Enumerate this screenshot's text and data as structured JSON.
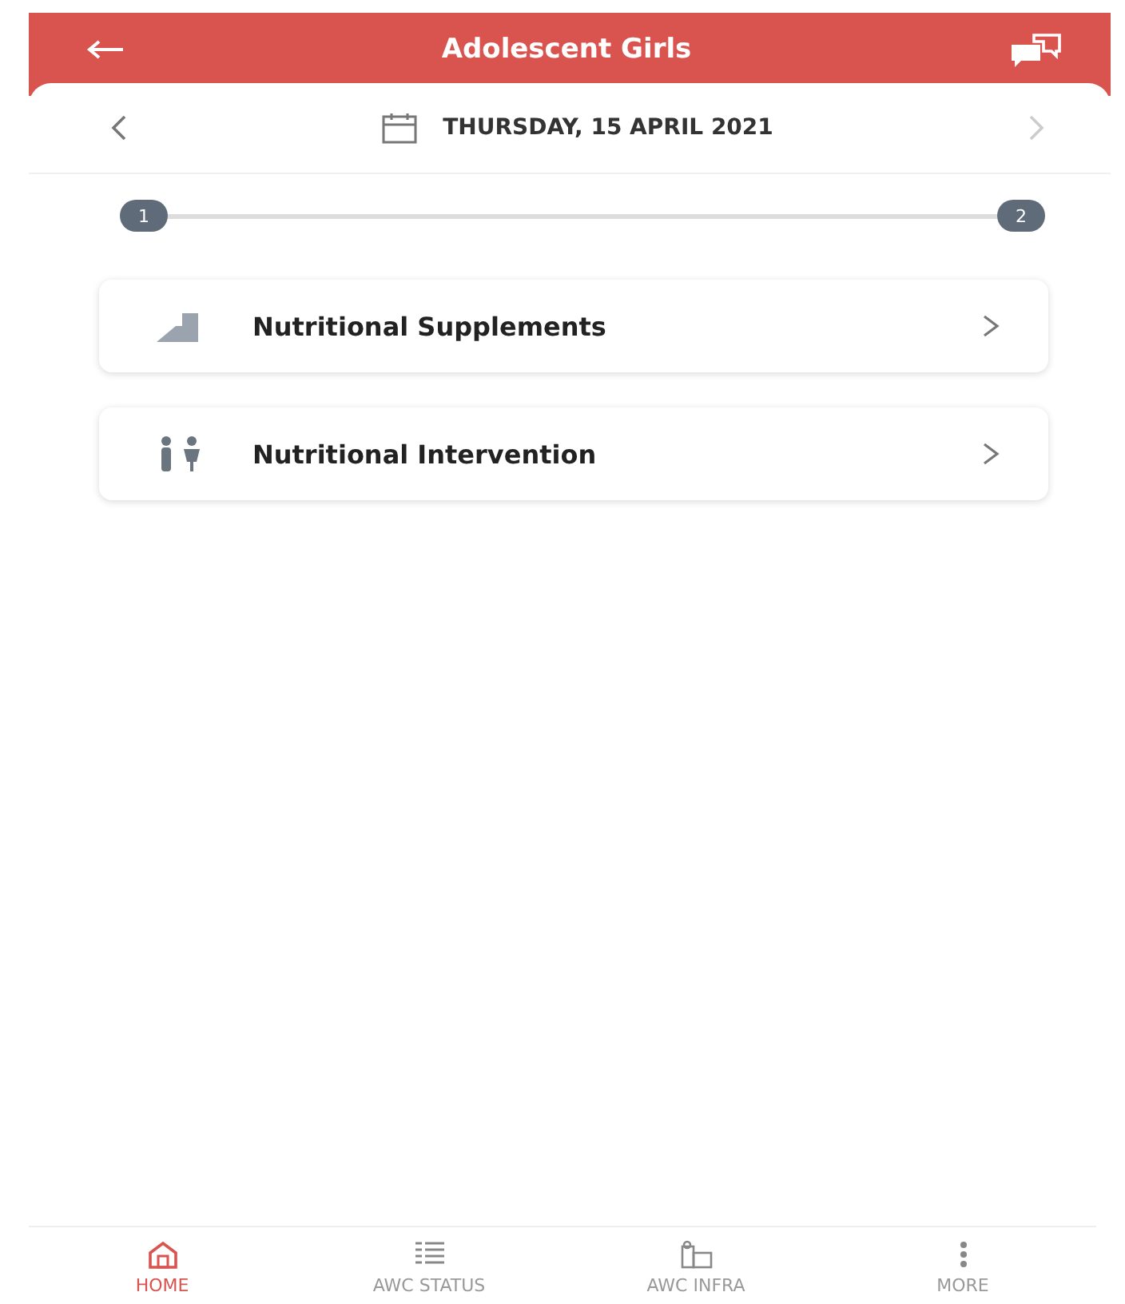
{
  "header": {
    "title": "Adolescent Girls"
  },
  "date_bar": {
    "date": "THURSDAY, 15 APRIL 2021"
  },
  "stepper": {
    "steps": [
      {
        "label": "1"
      },
      {
        "label": "2"
      }
    ]
  },
  "menu_items": [
    {
      "label": "Nutritional Supplements",
      "kind": "supplements"
    },
    {
      "label": "Nutritional Intervention",
      "kind": "intervention"
    }
  ],
  "bottom_nav": [
    {
      "label": "HOME",
      "kind": "home",
      "selected": true
    },
    {
      "label": "AWC STATUS",
      "kind": "status",
      "selected": false
    },
    {
      "label": "AWC INFRA",
      "kind": "infra",
      "selected": false
    },
    {
      "label": "MORE",
      "kind": "more",
      "selected": false
    }
  ]
}
